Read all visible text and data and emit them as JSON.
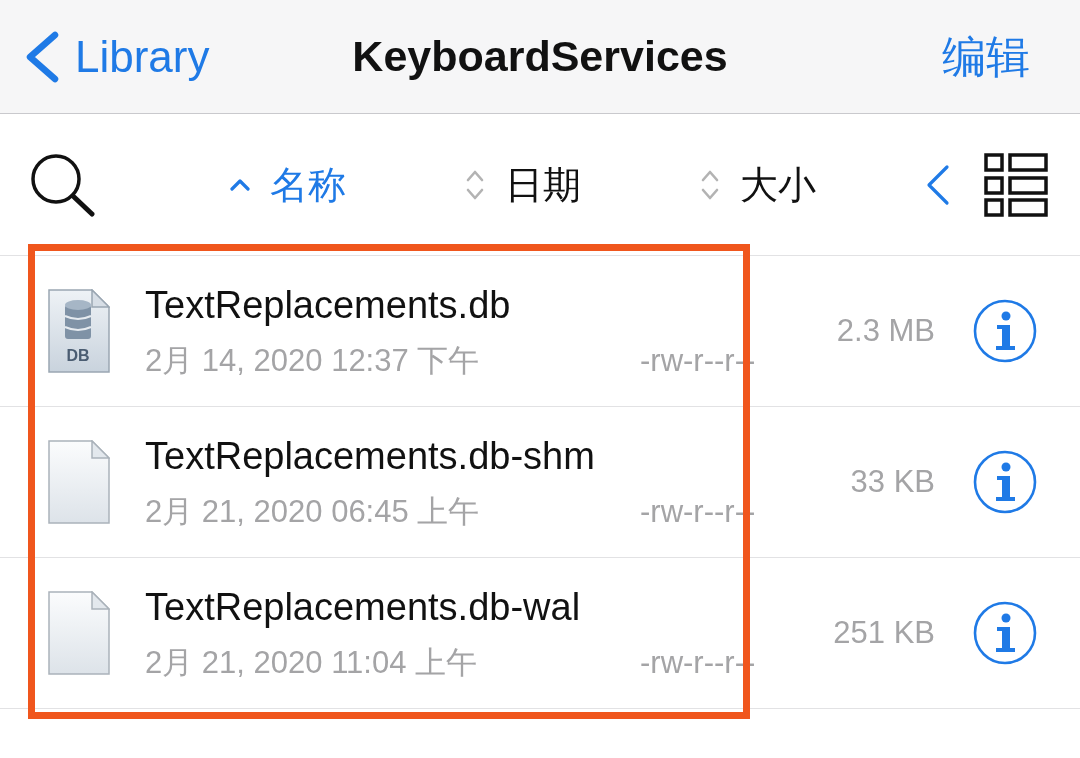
{
  "nav_bar": {
    "back_label": "Library",
    "title": "KeyboardServices",
    "action": "编辑"
  },
  "sort_bar": {
    "columns": [
      {
        "label": "名称",
        "selected": true
      },
      {
        "label": "日期",
        "selected": false
      },
      {
        "label": "大小",
        "selected": false
      }
    ]
  },
  "files": [
    {
      "kind": "database",
      "icon_label": "DB",
      "name": "TextReplacements.db",
      "date": "2月 14, 2020 12:37 下午",
      "permissions": "-rw-r--r--",
      "size": "2.3 MB",
      "highlighted": true
    },
    {
      "kind": "document",
      "name": "TextReplacements.db-shm",
      "date": "2月 21, 2020 06:45 上午",
      "permissions": "-rw-r--r--",
      "size": "33 KB",
      "highlighted": true
    },
    {
      "kind": "document",
      "name": "TextReplacements.db-wal",
      "date": "2月 21, 2020 11:04 上午",
      "permissions": "-rw-r--r--",
      "size": "251 KB",
      "highlighted": true
    }
  ]
}
